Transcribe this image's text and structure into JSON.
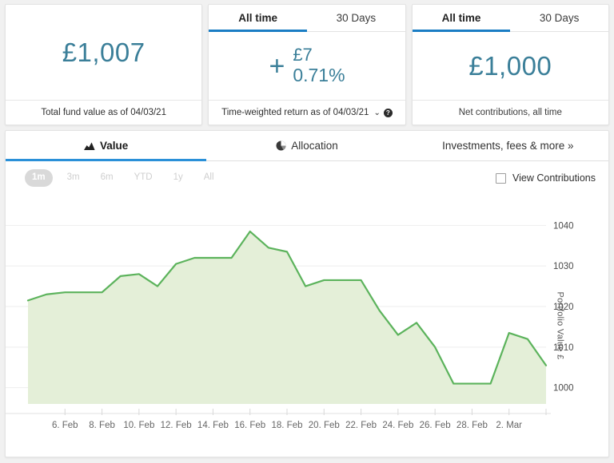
{
  "cards": [
    {
      "id": "total-fund-value",
      "tabs": [],
      "value": "£1,007",
      "footer": "Total fund value as of 04/03/21",
      "has_caret": false,
      "has_help": false
    },
    {
      "id": "time-weighted-return",
      "tabs": [
        {
          "label": "All time",
          "active": true
        },
        {
          "label": "30 Days",
          "active": false
        }
      ],
      "sign": "+",
      "amount": "£7",
      "percent": "0.71%",
      "footer": "Time-weighted return as of 04/03/21",
      "caret": "⌄",
      "help": "?",
      "has_caret": true,
      "has_help": true
    },
    {
      "id": "net-contributions",
      "tabs": [
        {
          "label": "All time",
          "active": true
        },
        {
          "label": "30 Days",
          "active": false
        }
      ],
      "value": "£1,000",
      "footer": "Net contributions, all time",
      "has_caret": false,
      "has_help": false
    }
  ],
  "main_tabs": [
    {
      "label": "Value",
      "icon": "area-chart-icon",
      "active": true
    },
    {
      "label": "Allocation",
      "icon": "pie-chart-icon",
      "active": false
    },
    {
      "label": "Investments, fees & more »",
      "icon": "none",
      "active": false
    }
  ],
  "ranges": [
    {
      "label": "1m",
      "selected": true
    },
    {
      "label": "3m",
      "selected": false
    },
    {
      "label": "6m",
      "selected": false
    },
    {
      "label": "YTD",
      "selected": false
    },
    {
      "label": "1y",
      "selected": false
    },
    {
      "label": "All",
      "selected": false
    }
  ],
  "view_contributions": {
    "label": "View Contributions",
    "checked": false
  },
  "colors": {
    "accent_teal": "#3b7f99",
    "tab_blue": "#1a7dc4",
    "line_green": "#5cb35c",
    "fill_green": "#e4efd8"
  },
  "chart_data": {
    "type": "area",
    "title": "",
    "xlabel": "",
    "ylabel": "Portfolio Value £",
    "ylim": [
      996,
      1044
    ],
    "yticks": [
      1000,
      1010,
      1020,
      1030,
      1040
    ],
    "grid": true,
    "legend": "none",
    "line_color": "#5cb35c",
    "fill_color": "#e4efd8",
    "xticks": [
      "6. Feb",
      "8. Feb",
      "10. Feb",
      "12. Feb",
      "14. Feb",
      "16. Feb",
      "18. Feb",
      "20. Feb",
      "22. Feb",
      "24. Feb",
      "26. Feb",
      "28. Feb",
      "2. Mar"
    ],
    "x": [
      "4. Feb",
      "5. Feb",
      "6. Feb",
      "7. Feb",
      "8. Feb",
      "9. Feb",
      "10. Feb",
      "11. Feb",
      "12. Feb",
      "13. Feb",
      "14. Feb",
      "15. Feb",
      "16. Feb",
      "17. Feb",
      "18. Feb",
      "19. Feb",
      "20. Feb",
      "21. Feb",
      "22. Feb",
      "23. Feb",
      "24. Feb",
      "25. Feb",
      "26. Feb",
      "27. Feb",
      "28. Feb",
      "1. Mar",
      "2. Mar",
      "3. Mar",
      "4. Mar"
    ],
    "values": [
      1021.5,
      1023.0,
      1023.5,
      1023.5,
      1023.5,
      1027.5,
      1028.0,
      1025.0,
      1030.5,
      1032.0,
      1032.0,
      1032.0,
      1038.5,
      1034.5,
      1033.5,
      1025.0,
      1026.5,
      1026.5,
      1026.5,
      1019.0,
      1013.0,
      1016.0,
      1010.0,
      1001.0,
      1001.0,
      1001.0,
      1013.5,
      1012.0,
      1005.5
    ]
  }
}
